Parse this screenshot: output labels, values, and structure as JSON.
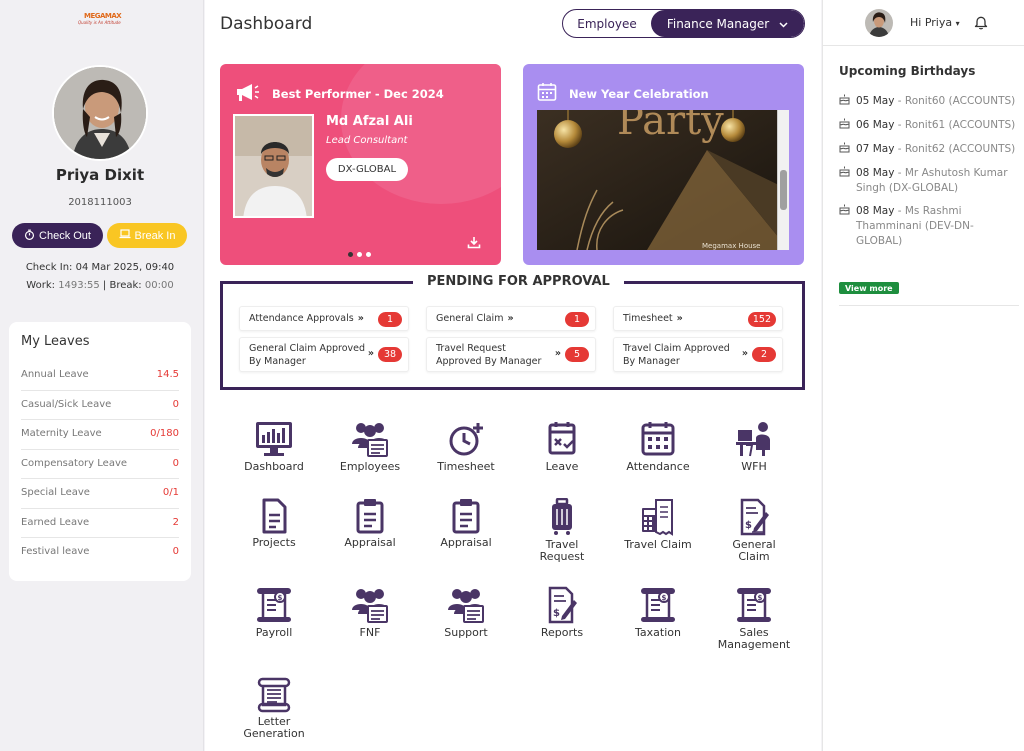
{
  "app": {
    "logo_text": "MEGAMAX",
    "logo_tagline": "Quality is An Attitude"
  },
  "profile": {
    "name": "Priya Dixit",
    "employee_id": "2018111003",
    "check_out_label": "Check Out",
    "break_in_label": "Break In",
    "check_in_text": "Check In: 04 Mar 2025, 09:40",
    "work_label": "Work:",
    "work_value": "1493:55",
    "break_label": "| Break:",
    "break_value": "00:00"
  },
  "leaves": {
    "title": "My Leaves",
    "items": [
      {
        "label": "Annual Leave",
        "value": "14.5"
      },
      {
        "label": "Casual/Sick Leave",
        "value": "0"
      },
      {
        "label": "Maternity Leave",
        "value": "0/180"
      },
      {
        "label": "Compensatory Leave",
        "value": "0"
      },
      {
        "label": "Special Leave",
        "value": "0/1"
      },
      {
        "label": "Earned Leave",
        "value": "2"
      },
      {
        "label": "Festival leave",
        "value": "0"
      }
    ]
  },
  "header": {
    "title": "Dashboard",
    "role_employee": "Employee",
    "role_finance": "Finance Manager"
  },
  "performer": {
    "title": "Best Performer - Dec 2024",
    "name": "Md Afzal Ali",
    "role": "Lead Consultant",
    "badge": "DX-GLOBAL"
  },
  "celebration": {
    "title": "New Year Celebration",
    "image_text": "Party",
    "caption": "Megamax House"
  },
  "pending": {
    "title": "PENDING FOR APPROVAL",
    "items": [
      {
        "label": "Attendance Approvals",
        "count": "1"
      },
      {
        "label": "General Claim",
        "count": "1"
      },
      {
        "label": "Timesheet",
        "count": "152"
      },
      {
        "label1": "General Claim Approved",
        "label2": "By Manager",
        "count": "38"
      },
      {
        "label1": "Travel Request",
        "label2": "Approved By Manager",
        "count": "5"
      },
      {
        "label1": "Travel Claim Approved",
        "label2": "By Manager",
        "count": "2"
      }
    ]
  },
  "apps": [
    {
      "l1": "Dashboard",
      "l2": "",
      "icon": "dashboard-icon"
    },
    {
      "l1": "Employees",
      "l2": "",
      "icon": "employees-icon"
    },
    {
      "l1": "Timesheet",
      "l2": "",
      "icon": "timesheet-icon"
    },
    {
      "l1": "Leave",
      "l2": "",
      "icon": "leave-icon"
    },
    {
      "l1": "Attendance",
      "l2": "",
      "icon": "attendance-icon"
    },
    {
      "l1": "WFH",
      "l2": "",
      "icon": "wfh-icon"
    },
    {
      "l1": "Projects",
      "l2": "",
      "icon": "document-icon"
    },
    {
      "l1": "Appraisal",
      "l2": "",
      "icon": "clipboard-icon"
    },
    {
      "l1": "Appraisal",
      "l2": "",
      "icon": "clipboard-icon"
    },
    {
      "l1": "Travel",
      "l2": "Request",
      "icon": "luggage-icon"
    },
    {
      "l1": "Travel Claim",
      "l2": "",
      "icon": "calculator-receipt-icon"
    },
    {
      "l1": "General",
      "l2": "Claim",
      "icon": "claim-form-icon"
    },
    {
      "l1": "Payroll",
      "l2": "",
      "icon": "scroll-money-icon"
    },
    {
      "l1": "FNF",
      "l2": "",
      "icon": "employees-icon"
    },
    {
      "l1": "Support",
      "l2": "",
      "icon": "employees-icon"
    },
    {
      "l1": "Reports",
      "l2": "",
      "icon": "report-pen-icon"
    },
    {
      "l1": "Taxation",
      "l2": "",
      "icon": "scroll-money-icon"
    },
    {
      "l1": "Sales",
      "l2": "Management",
      "icon": "scroll-money-icon"
    },
    {
      "l1": "Letter",
      "l2": "Generation",
      "icon": "letter-scroll-icon"
    }
  ],
  "user": {
    "greeting": "Hi Priya"
  },
  "birthdays": {
    "title": "Upcoming Birthdays",
    "items": [
      {
        "date": "05 May",
        "text": "- Ronit60 (ACCOUNTS)"
      },
      {
        "date": "06 May",
        "text": "- Ronit61 (ACCOUNTS)"
      },
      {
        "date": "07 May",
        "text": "- Ronit62 (ACCOUNTS)"
      },
      {
        "date": "08 May",
        "text": "- Mr Ashutosh Kumar Singh (DX-GLOBAL)"
      },
      {
        "date": "08 May",
        "text": "- Ms Rashmi Thamminani (DEV-DN-GLOBAL)"
      }
    ],
    "view_more": "View more"
  },
  "colors": {
    "primary": "#3a2358",
    "pink_card": "#ee4f7b",
    "purple_card": "#a98ef0",
    "badge_red": "#e53935",
    "break_yellow": "#f9c623",
    "view_more_green": "#1e8e3e"
  }
}
